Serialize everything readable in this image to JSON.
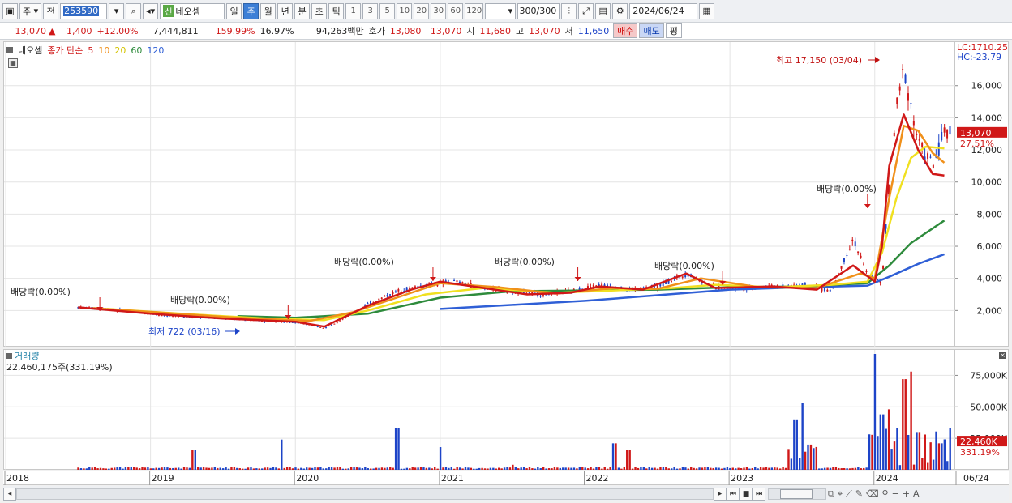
{
  "toolbar": {
    "market": "주",
    "market_mode": "전",
    "code": "253590",
    "badge": "신",
    "name": "네오셈",
    "periods": [
      "일",
      "주",
      "월",
      "년",
      "분",
      "초",
      "틱"
    ],
    "active_period": "주",
    "minute_options": [
      "1",
      "3",
      "5",
      "10",
      "20",
      "30",
      "60",
      "120"
    ],
    "count": "300/300",
    "date": "2024/06/24"
  },
  "quote": {
    "price": "13,070",
    "change_arrow": "▲",
    "change": "1,400",
    "change_pct": "+12.00%",
    "volume": "7,444,811",
    "vol_ratio": "159.99%",
    "turnover": "16.97%",
    "amount": "94,263백만",
    "hoga_label": "호가",
    "ask": "13,080",
    "bid": "13,070",
    "open_label": "시",
    "open": "11,680",
    "high_label": "고",
    "high": "13,070",
    "low_label": "저",
    "low": "11,650",
    "buy_label": "매수",
    "sell_label": "매도",
    "flat_label": "평"
  },
  "price_pane": {
    "name": "네오셈",
    "legend_label": "종가 단순",
    "ma_legend": [
      {
        "period": "5",
        "color": "#d01818"
      },
      {
        "period": "10",
        "color": "#f0901a"
      },
      {
        "period": "20",
        "color": "#f0e020"
      },
      {
        "period": "60",
        "color": "#2e8b3c"
      },
      {
        "period": "120",
        "color": "#2f5fd6"
      }
    ],
    "lc_label": "LC:1710.25",
    "hc_label": "HC:-23.79",
    "current_tag": "13,070",
    "current_pct": "27.51%",
    "max_annotation": "최고 17,150 (03/04)",
    "min_annotation": "최저 722 (03/16)",
    "dividend_label": "배당락(0.00%)",
    "y_ticks": [
      "2,000",
      "4,000",
      "6,000",
      "8,000",
      "10,000",
      "12,000",
      "14,000",
      "16,000"
    ]
  },
  "volume_pane": {
    "title": "거래량",
    "summary": "22,460,175주(331.19%)",
    "current_tag": "22,460K",
    "current_pct": "331.19%",
    "y_ticks": [
      "25,000K",
      "50,000K",
      "75,000K"
    ]
  },
  "xaxis": {
    "labels": [
      "2018",
      "2019",
      "2020",
      "2021",
      "2022",
      "2023",
      "2024"
    ],
    "end_label": "06/24"
  },
  "chart_data": {
    "type": "line",
    "title": "",
    "price": {
      "years": [
        2018.5,
        2018.7,
        2018.9,
        2019.1,
        2019.3,
        2019.5,
        2019.7,
        2019.9,
        2020.05,
        2020.2,
        2020.35,
        2020.5,
        2020.7,
        2020.9,
        2021.1,
        2021.3,
        2021.5,
        2021.7,
        2021.9,
        2022.1,
        2022.3,
        2022.5,
        2022.7,
        2022.9,
        2023.1,
        2023.3,
        2023.5,
        2023.7,
        2023.85,
        2023.95,
        2024.05,
        2024.1,
        2024.15,
        2024.2,
        2024.3,
        2024.4,
        2024.48
      ],
      "values": [
        2200,
        2100,
        1900,
        1700,
        1600,
        1500,
        1400,
        1300,
        1200,
        900,
        1600,
        2400,
        3200,
        3600,
        3800,
        3400,
        3200,
        3000,
        3200,
        3600,
        3300,
        3500,
        4300,
        3400,
        3400,
        3500,
        3600,
        3200,
        6500,
        4200,
        3700,
        10000,
        14500,
        17150,
        12500,
        11000,
        13070
      ]
    },
    "ma5": {
      "years": [
        2018.5,
        2019.0,
        2019.5,
        2020.0,
        2020.2,
        2020.5,
        2020.8,
        2021.0,
        2021.3,
        2021.6,
        2021.9,
        2022.1,
        2022.4,
        2022.7,
        2022.9,
        2023.3,
        2023.6,
        2023.85,
        2024.0,
        2024.05,
        2024.1,
        2024.2,
        2024.3,
        2024.4,
        2024.48
      ],
      "values": [
        2200,
        1800,
        1500,
        1300,
        1000,
        2300,
        3300,
        3800,
        3400,
        3000,
        3100,
        3500,
        3300,
        4300,
        3400,
        3500,
        3300,
        4800,
        3800,
        6000,
        11000,
        14200,
        12000,
        10500,
        10400
      ]
    },
    "ma10": {
      "years": [
        2018.6,
        2019.1,
        2019.6,
        2020.1,
        2020.4,
        2020.8,
        2021.0,
        2021.4,
        2021.8,
        2022.2,
        2022.5,
        2022.8,
        2023.2,
        2023.6,
        2023.9,
        2024.0,
        2024.1,
        2024.2,
        2024.3,
        2024.4,
        2024.48
      ],
      "values": [
        2150,
        1850,
        1550,
        1350,
        1900,
        3100,
        3700,
        3450,
        3050,
        3400,
        3350,
        4000,
        3450,
        3400,
        4300,
        4000,
        9000,
        13500,
        13200,
        11800,
        11200
      ]
    },
    "ma20": {
      "years": [
        2018.7,
        2019.3,
        2019.8,
        2020.2,
        2020.5,
        2020.9,
        2021.3,
        2021.8,
        2022.2,
        2022.6,
        2022.9,
        2023.3,
        2023.7,
        2023.95,
        2024.05,
        2024.15,
        2024.25,
        2024.35,
        2024.48
      ],
      "values": [
        2100,
        1750,
        1500,
        1400,
        2000,
        3000,
        3400,
        3100,
        3250,
        3400,
        3600,
        3450,
        3600,
        3800,
        5600,
        9000,
        11500,
        12200,
        12100
      ]
    },
    "ma60": {
      "years": [
        2019.6,
        2020.0,
        2020.5,
        2021.0,
        2021.5,
        2022.0,
        2022.5,
        2023.0,
        2023.5,
        2023.95,
        2024.1,
        2024.25,
        2024.48
      ],
      "values": [
        1650,
        1550,
        1800,
        2800,
        3200,
        3250,
        3300,
        3450,
        3500,
        3700,
        4800,
        6200,
        7600
      ]
    },
    "ma120": {
      "years": [
        2021.0,
        2021.5,
        2022.0,
        2022.5,
        2023.0,
        2023.5,
        2023.95,
        2024.1,
        2024.3,
        2024.48
      ],
      "values": [
        2100,
        2350,
        2600,
        2950,
        3300,
        3450,
        3550,
        4100,
        4900,
        5500
      ]
    },
    "volume_k": {
      "years": [
        2018.5,
        2019.3,
        2019.9,
        2020.7,
        2021.0,
        2021.5,
        2022.2,
        2022.3,
        2023.45,
        2023.5,
        2023.55,
        2024.0,
        2024.05,
        2024.1,
        2024.15,
        2024.2,
        2024.25,
        2024.3,
        2024.35,
        2024.4,
        2024.45,
        2024.48
      ],
      "values": [
        1500,
        16000,
        24000,
        33000,
        18000,
        4000,
        21000,
        16000,
        40000,
        53000,
        20000,
        92000,
        44000,
        48000,
        33000,
        72000,
        78000,
        30000,
        28000,
        8000,
        21000,
        22460
      ]
    },
    "ylim_price": [
      0,
      17500
    ],
    "ylim_volume": [
      0,
      92000
    ],
    "xlim": [
      2018.0,
      2024.55
    ]
  }
}
